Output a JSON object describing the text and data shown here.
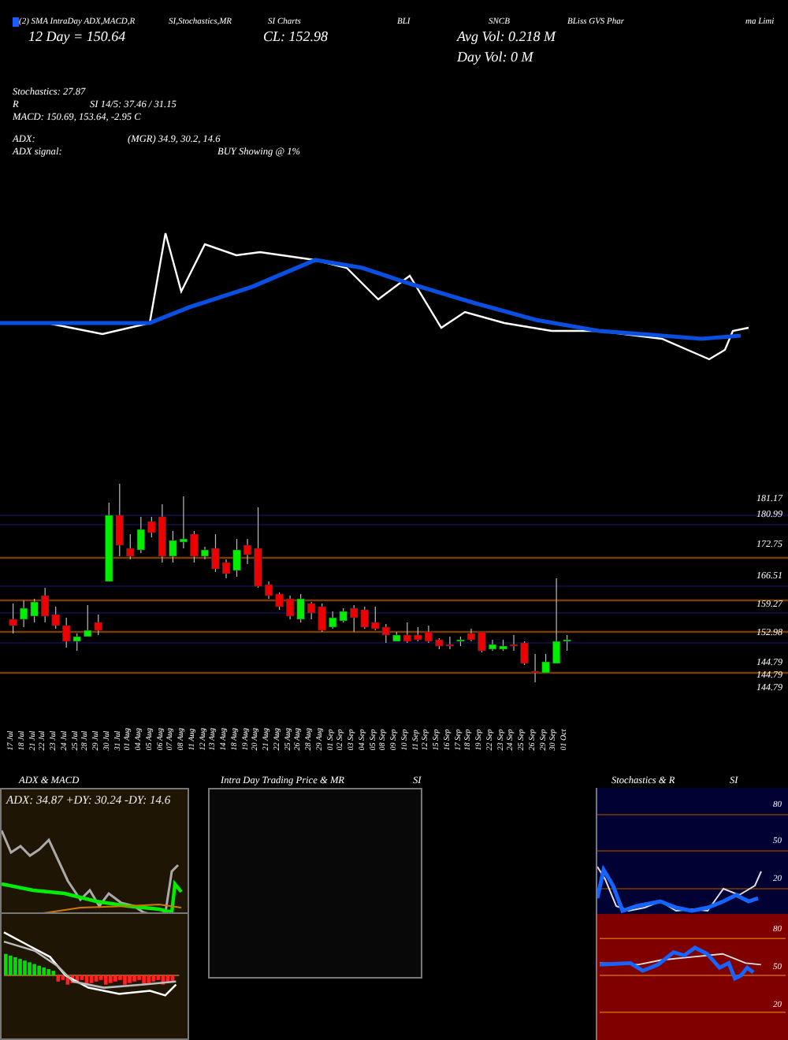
{
  "header": {
    "legend": [
      "(2) SMA IntraDay ADX,MACD,R",
      "SI,Stochastics,MR",
      "SI Charts",
      "BLI",
      "SNCB",
      "BLiss GVS Phar",
      "ma Limi"
    ],
    "sma": "12  Day = 150.64",
    "close": "CL: 152.98",
    "avg_vol": "Avg Vol: 0.218   M",
    "day_vol": "Day Vol: 0   M"
  },
  "stats": [
    {
      "label": "Stochastics: 27.87"
    },
    {
      "label": "R",
      "value": "SI 14/5: 37.46  / 31.15"
    },
    {
      "label": "MACD: 150.69,  153.64,  -2.95 C"
    },
    {
      "label": "ADX:",
      "value": "(MGR) 34.9,  30.2,  14.6"
    },
    {
      "label": "ADX  signal:",
      "value": "BUY Showing @ 1%"
    }
  ],
  "price_labels": [
    "181.17",
    "180.99",
    "172.75",
    "166.51",
    "159.27",
    "152.98",
    "144.79",
    "144.79",
    "144.79"
  ],
  "dates": [
    "17 Jul",
    "18 Jul",
    "21 Jul",
    "22 Jul",
    "23 Jul",
    "24 Jul",
    "25 Jul",
    "28 Jul",
    "29 Jul",
    "30 Jul",
    "31 Jul",
    "01 Aug",
    "04 Aug",
    "05 Aug",
    "06 Aug",
    "07 Aug",
    "08 Aug",
    "11 Aug",
    "12 Aug",
    "13 Aug",
    "14 Aug",
    "18 Aug",
    "19 Aug",
    "20 Aug",
    "21 Aug",
    "22 Aug",
    "25 Aug",
    "26 Aug",
    "28 Aug",
    "29 Aug",
    "01 Sep",
    "02 Sep",
    "03 Sep",
    "04 Sep",
    "05 Sep",
    "08 Sep",
    "09 Sep",
    "10 Sep",
    "11 Sep",
    "12 Sep",
    "15 Sep",
    "16 Sep",
    "17 Sep",
    "18 Sep",
    "19 Sep",
    "22 Sep",
    "23 Sep",
    "24 Sep",
    "25 Sep",
    "26 Sep",
    "29 Sep",
    "30 Sep",
    "01 Oct"
  ],
  "panels": {
    "adx_title": "ADX  & MACD",
    "adx_reading": "ADX: 34.87 +DY: 30.24  -DY: 14.6",
    "intraday_title": "Intra  Day Trading Price  & MR",
    "intraday_title_2": "SI",
    "stoch_title": "Stochastics & R",
    "stoch_title_2": "SI",
    "upper_ticks": [
      "80",
      "50",
      "20"
    ],
    "lower_ticks": [
      "80",
      "50",
      "20"
    ]
  }
}
